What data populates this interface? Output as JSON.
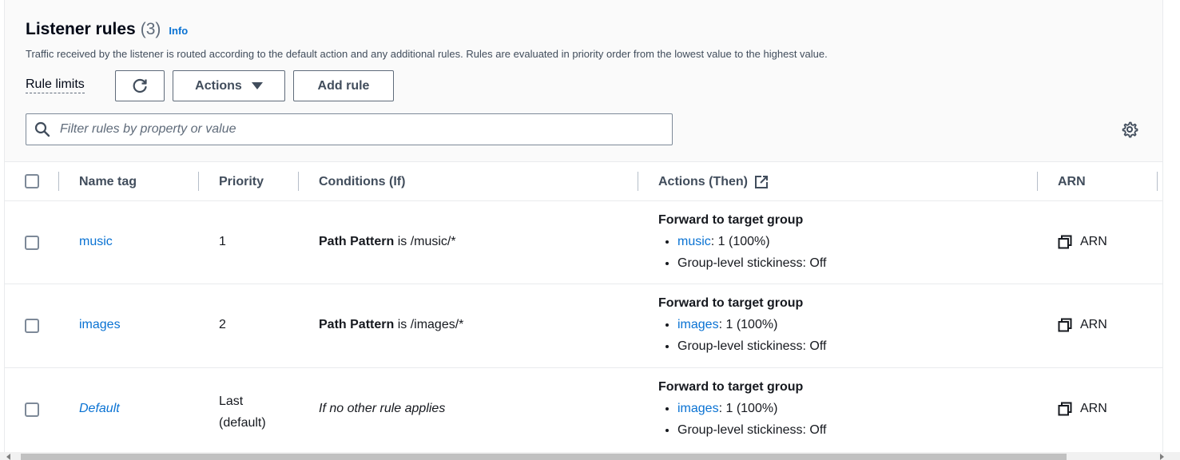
{
  "header": {
    "title": "Listener rules",
    "count": "(3)",
    "info": "Info",
    "description": "Traffic received by the listener is routed according to the default action and any additional rules. Rules are evaluated in priority order from the lowest value to the highest value.",
    "rule_limits": "Rule limits",
    "actions_label": "Actions",
    "add_rule_label": "Add rule"
  },
  "search": {
    "placeholder": "Filter rules by property or value"
  },
  "columns": {
    "name_tag": "Name tag",
    "priority": "Priority",
    "conditions": "Conditions (If)",
    "actions": "Actions (Then)",
    "arn": "ARN"
  },
  "rows": [
    {
      "name": "music",
      "priority": "1",
      "condition_key": "Path Pattern",
      "condition_rest": " is /music/*",
      "action_title": "Forward to target group",
      "target_link": "music",
      "target_weight": ": 1 (100%)",
      "stickiness": "Group-level stickiness: Off",
      "arn": "ARN"
    },
    {
      "name": "images",
      "priority": "2",
      "condition_key": "Path Pattern",
      "condition_rest": " is /images/*",
      "action_title": "Forward to target group",
      "target_link": "images",
      "target_weight": ": 1 (100%)",
      "stickiness": "Group-level stickiness: Off",
      "arn": "ARN"
    },
    {
      "name": "Default",
      "priority_line1": "Last",
      "priority_line2": "(default)",
      "condition": "If no other rule applies",
      "action_title": "Forward to target group",
      "target_link": "images",
      "target_weight": ": 1 (100%)",
      "stickiness": "Group-level stickiness: Off",
      "arn": "ARN"
    }
  ],
  "colors": {
    "link": "#0972d3",
    "text": "#16191f",
    "header_bg": "#fafafa",
    "border": "#e9ebed"
  }
}
